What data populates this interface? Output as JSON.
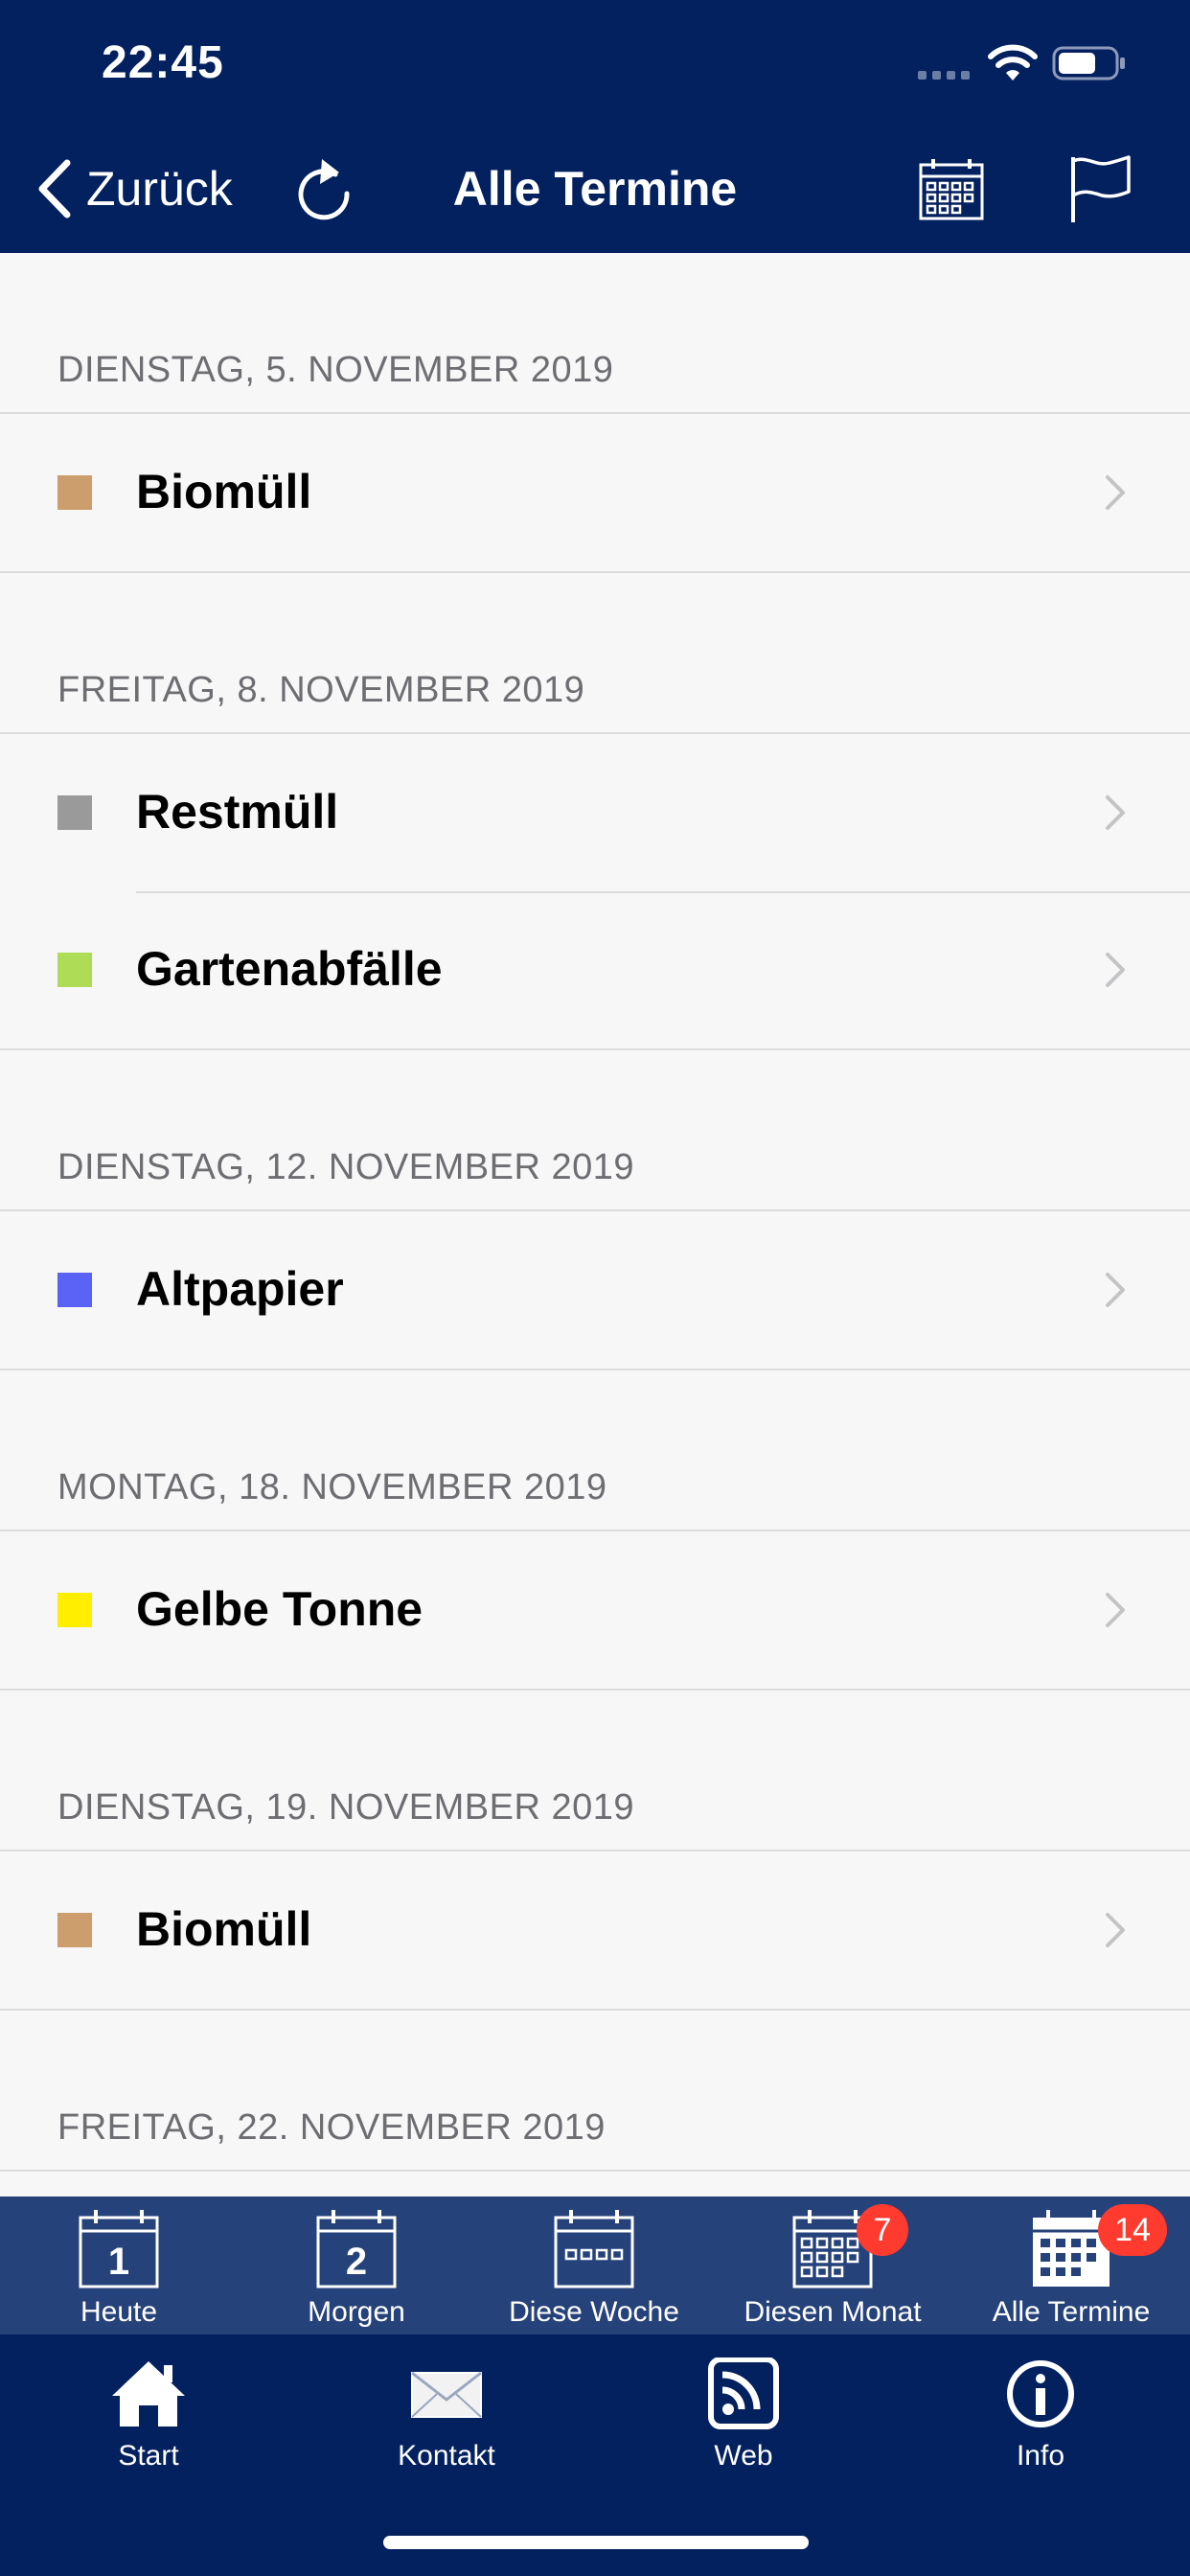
{
  "status": {
    "time": "22:45"
  },
  "nav": {
    "back_label": "Zurück",
    "title": "Alle Termine"
  },
  "sections": [
    {
      "date": "DIENSTAG, 5. NOVEMBER 2019",
      "items": [
        {
          "label": "Biomüll",
          "color": "#cc9e6e"
        }
      ]
    },
    {
      "date": "FREITAG, 8. NOVEMBER 2019",
      "items": [
        {
          "label": "Restmüll",
          "color": "#9a9a9a"
        },
        {
          "label": "Gartenabfälle",
          "color": "#afdc57"
        }
      ]
    },
    {
      "date": "DIENSTAG, 12. NOVEMBER 2019",
      "items": [
        {
          "label": "Altpapier",
          "color": "#5a63f5"
        }
      ]
    },
    {
      "date": "MONTAG, 18. NOVEMBER 2019",
      "items": [
        {
          "label": "Gelbe Tonne",
          "color": "#ffee00"
        }
      ]
    },
    {
      "date": "DIENSTAG, 19. NOVEMBER 2019",
      "items": [
        {
          "label": "Biomüll",
          "color": "#cc9e6e"
        }
      ]
    },
    {
      "date": "FREITAG, 22. NOVEMBER 2019",
      "items": []
    }
  ],
  "tabs_top": [
    {
      "label": "Heute",
      "icon": "calendar-day-1-icon",
      "number": "1"
    },
    {
      "label": "Morgen",
      "icon": "calendar-day-2-icon",
      "number": "2"
    },
    {
      "label": "Diese Woche",
      "icon": "calendar-week-icon"
    },
    {
      "label": "Diesen Monat",
      "icon": "calendar-month-icon",
      "badge": "7"
    },
    {
      "label": "Alle Termine",
      "icon": "calendar-all-icon",
      "badge": "14"
    }
  ],
  "tabs_bottom": [
    {
      "label": "Start",
      "icon": "home-icon"
    },
    {
      "label": "Kontakt",
      "icon": "envelope-icon"
    },
    {
      "label": "Web",
      "icon": "rss-icon"
    },
    {
      "label": "Info",
      "icon": "info-icon"
    }
  ],
  "colors": {
    "nav_bg": "#03205f",
    "tab_bg": "#26427a",
    "badge": "#ff3b30"
  }
}
